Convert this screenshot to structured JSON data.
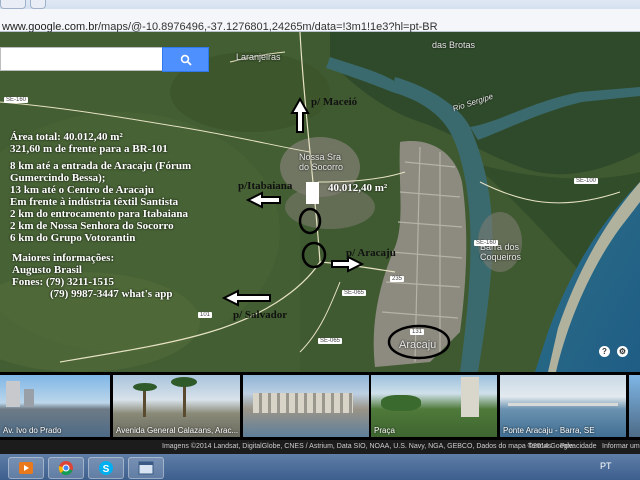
{
  "browser": {
    "url_prefix": "www.google.com.br",
    "url_path": "/maps/@-10.8976496,-37.1276801,24265m/data=!3m1!1e3?hl=pt-BR"
  },
  "map": {
    "places": {
      "laranjeiras": "Laranjeiras",
      "das_brotas": "das Brotas",
      "rio_sergipe": "Rio Sergipe",
      "nossa_sra": "Nossa Sra",
      "do_socorro": "do Socorro",
      "barra_dos": "Barra dos",
      "coqueiros": "Coqueiros",
      "aracaju": "Aracaju"
    },
    "road_tags": {
      "se160_left": "SE-160",
      "se100": "SE-100",
      "se160_mid": "SE-160",
      "br235": "235",
      "se065": "SE-065",
      "br101": "101",
      "se065b": "SE-065",
      "br131": "131"
    }
  },
  "annotations": {
    "area_total": "Área total: 40.012,40 m²",
    "frente": "321,60 m de frente para a BR-101",
    "line1": "8 km até a entrada de Aracaju (Fórum",
    "line2": "Gumercindo Bessa);",
    "line3": "13 km até o Centro de Aracaju",
    "line4": "Em frente à indústria têxtil Santista",
    "line5": "2 km do entrocamento para Itabaiana",
    "line6": "2 km de Nossa Senhora do Socorro",
    "line7": "6 km do Grupo Votorantin",
    "info_title": "Maiores informações:",
    "contact_name": "Augusto Brasil",
    "fones": "Fones: (79) 3211-1515",
    "fone2": "(79) 9987-3447 what's app",
    "to_maceio": "p/ Maceió",
    "to_itabaiana": "p/Itabaiana",
    "area_label": "40.012,40 m²",
    "to_aracaju": "p/ Aracaju",
    "to_salvador": "p/ Salvador"
  },
  "photos": [
    {
      "caption": "Av. Ivo do Prado"
    },
    {
      "caption": "Avenida General Calazans, Arac..."
    },
    {
      "caption": ""
    },
    {
      "caption": "Praça"
    },
    {
      "caption": "Ponte Aracaju - Barra, SE"
    },
    {
      "caption": ""
    }
  ],
  "attribution": {
    "imagery": "Imagens ©2014 Landsat, DigitalGlobe, CNES / Astrium, Data SIO, NOAA, U.S. Navy, NGA, GEBCO, Dados do mapa ©2014 Google",
    "terms": "Termos",
    "privacy": "Privacidade",
    "report": "Informar um"
  },
  "taskbar": {
    "language": "PT"
  },
  "colors": {
    "search_button": "#4d90fe",
    "terrain": "#3f5a30",
    "water": "#3b6a6e"
  }
}
